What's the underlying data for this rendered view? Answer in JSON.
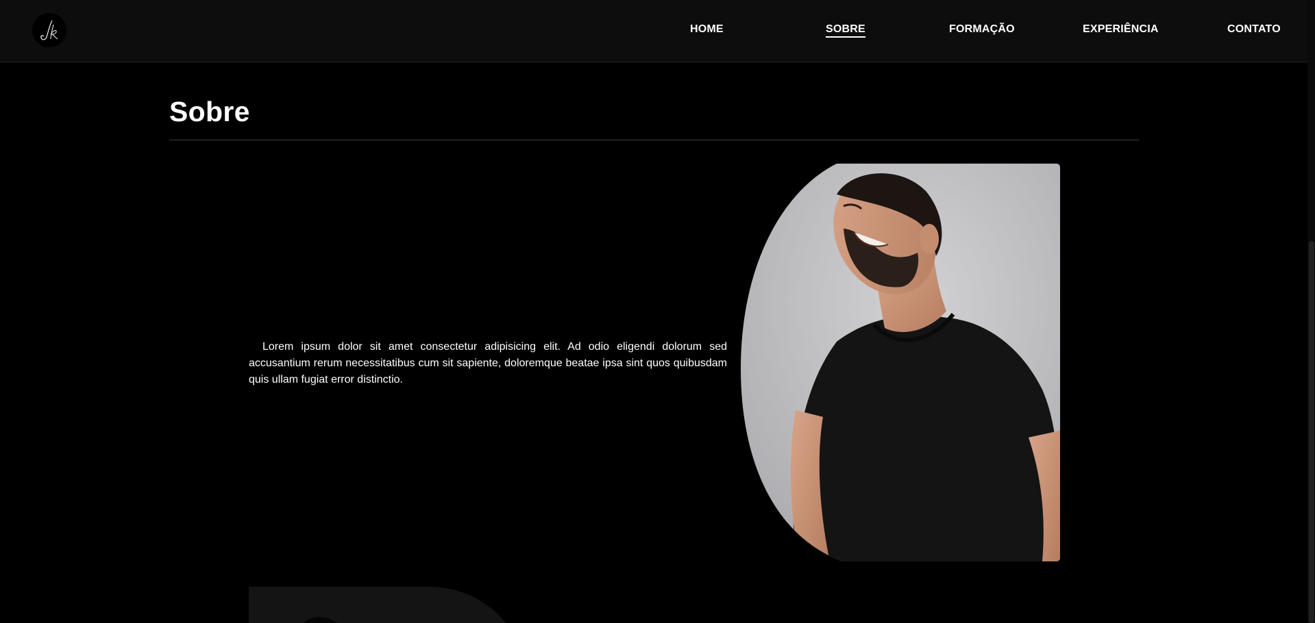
{
  "nav": {
    "logo_alt": "JK",
    "items": [
      {
        "label": "HOME",
        "active": false
      },
      {
        "label": "SOBRE",
        "active": true
      },
      {
        "label": "FORMAÇÃO",
        "active": false
      },
      {
        "label": "EXPERIÊNCIA",
        "active": false
      },
      {
        "label": "CONTATO",
        "active": false
      }
    ]
  },
  "about": {
    "title": "Sobre",
    "paragraph": "Lorem ipsum dolor sit amet consectetur adipisicing elit. Ad odio eligendi dolorum sed accusantium rerum necessitatibus cum sit sapiente, doloremque beatae ipsa sint quos quibusdam quis ullam fugiat error distinctio."
  },
  "colors": {
    "background": "#000000",
    "navbar": "#0d0d0d",
    "divider": "#3c3c3c",
    "text": "#ffffff"
  }
}
